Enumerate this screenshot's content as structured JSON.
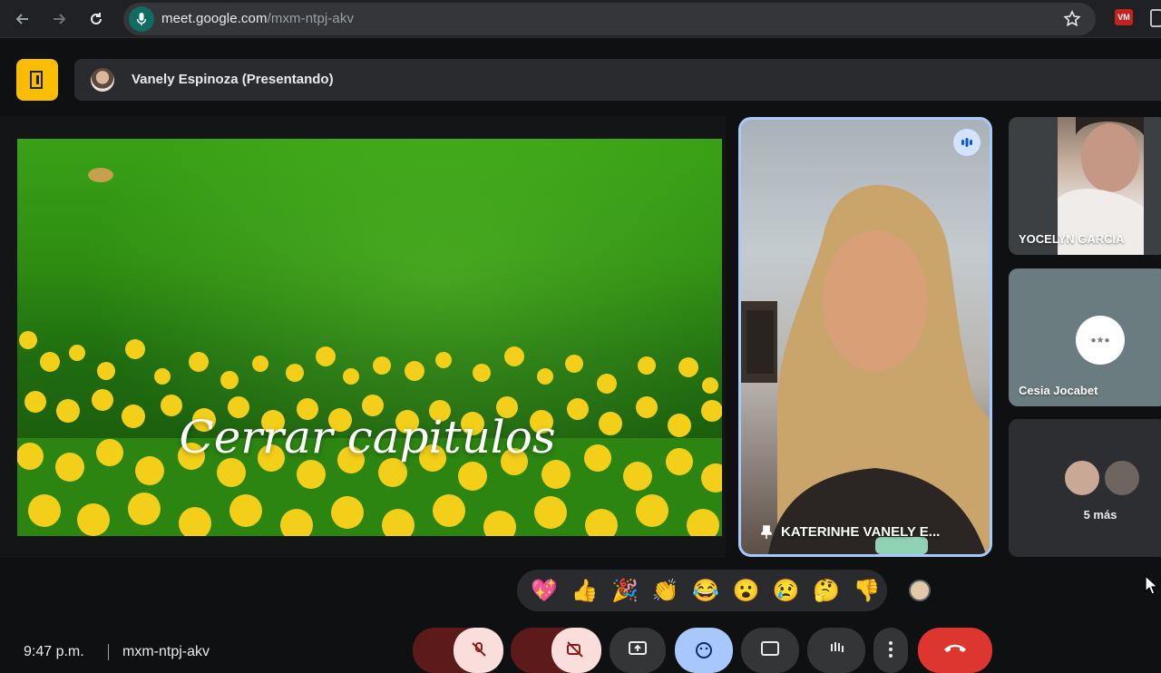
{
  "browser": {
    "url_host": "meet.google.com",
    "url_path": "/mxm-ntpj-akv",
    "icons": [
      "back-icon",
      "forward-icon",
      "reload-icon",
      "mic-icon",
      "star-icon"
    ],
    "extension_label": "VM"
  },
  "presenter_bar": {
    "name": "Vanely Espinoza (Presentando)"
  },
  "slide": {
    "title": "Cerrar capitulos"
  },
  "pinned_tile": {
    "name": "KATERINHE VANELY E..."
  },
  "side_tiles": [
    {
      "name": "YOCELYN GARCIA"
    },
    {
      "name": "Cesia Jocabet"
    },
    {
      "more": "5 más"
    }
  ],
  "reactions": [
    "💖",
    "👍",
    "🎉",
    "👏",
    "😂",
    "😮",
    "😢",
    "🤔",
    "👎"
  ],
  "footer": {
    "time": "9:47 p.m.",
    "meeting_code": "mxm-ntpj-akv"
  },
  "colors": {
    "accent_yellow": "#fbbc04",
    "pin_border": "#a8c7fa",
    "end_call": "#dc362e",
    "muted_bg": "#f9dedc",
    "active_bg": "#a8c7fa"
  }
}
